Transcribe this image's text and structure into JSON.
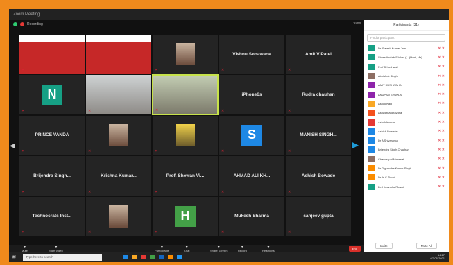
{
  "window": {
    "title": "Zoom Meeting",
    "recording": "Recording",
    "view_label": "View"
  },
  "grid": [
    {
      "name": "",
      "caption": "",
      "type": "video-red"
    },
    {
      "name": "",
      "caption": "",
      "type": "video-red"
    },
    {
      "name": "",
      "caption": "",
      "type": "photo"
    },
    {
      "name": "Vishnu Sonawane",
      "caption": "",
      "type": "name"
    },
    {
      "name": "Amit V Patel",
      "caption": "",
      "type": "name"
    },
    {
      "name": "N",
      "caption": "",
      "type": "avatar",
      "color": "#16a085"
    },
    {
      "name": "",
      "caption": "",
      "type": "video-gray"
    },
    {
      "name": "",
      "caption": "",
      "type": "video-green",
      "active": true
    },
    {
      "name": "iPhone6s",
      "caption": "",
      "type": "name"
    },
    {
      "name": "Rudra chauhan",
      "caption": "",
      "type": "name"
    },
    {
      "name": "PRINCE VANDA",
      "caption": "",
      "type": "name"
    },
    {
      "name": "",
      "caption": "",
      "type": "photo"
    },
    {
      "name": "",
      "caption": "",
      "type": "photo-yellow"
    },
    {
      "name": "S",
      "caption": "",
      "type": "avatar",
      "color": "#1e88e5"
    },
    {
      "name": "MANISH SINGH...",
      "caption": "",
      "type": "name"
    },
    {
      "name": "Brijendra Singh...",
      "caption": "",
      "type": "name"
    },
    {
      "name": "Krishna Kumar...",
      "caption": "",
      "type": "name"
    },
    {
      "name": "Prof. Shewan Vi...",
      "caption": "",
      "type": "name"
    },
    {
      "name": "AHMAD ALI KH...",
      "caption": "",
      "type": "name"
    },
    {
      "name": "Ashish Bowade",
      "caption": "",
      "type": "name"
    },
    {
      "name": "Technocrats Inst...",
      "caption": "",
      "type": "name"
    },
    {
      "name": "",
      "caption": "",
      "type": "photo"
    },
    {
      "name": "H",
      "caption": "",
      "type": "avatar",
      "color": "#43a047"
    },
    {
      "name": "Mukesh Sharma",
      "caption": "",
      "type": "name"
    },
    {
      "name": "sanjeev gupta",
      "caption": "",
      "type": "name"
    }
  ],
  "bottombar": [
    {
      "label": "Mute",
      "icon": "microphone-icon"
    },
    {
      "label": "Start Video",
      "icon": "video-icon"
    },
    {
      "label": "Participants",
      "icon": "participants-icon"
    },
    {
      "label": "Chat",
      "icon": "chat-icon"
    },
    {
      "label": "Share Screen",
      "icon": "share-icon"
    },
    {
      "label": "Record",
      "icon": "record-icon"
    },
    {
      "label": "Reactions",
      "icon": "reaction-icon"
    }
  ],
  "end_label": "End",
  "panel": {
    "title": "Participants (31)",
    "search_placeholder": "Find a participant",
    "items": [
      {
        "name": "Dr. Rajesh Kumar Jain",
        "color": "#16a085"
      },
      {
        "name": "Shree Amitab Sridhar (... (Host, Me)",
        "color": "#16a085"
      },
      {
        "name": "Prof D Kushwah",
        "color": "#16a085"
      },
      {
        "name": "Abhishek Singh",
        "color": "#8d6e63"
      },
      {
        "name": "AMIT KUSHWAHA",
        "color": "#8e24aa"
      },
      {
        "name": "ANUPAM SHUKLA",
        "color": "#8e24aa"
      },
      {
        "name": "Ashok Kaul",
        "color": "#f9a825"
      },
      {
        "name": "Ashwathanarayana",
        "color": "#f4511e"
      },
      {
        "name": "Ashok Kumar",
        "color": "#e53935"
      },
      {
        "name": "Ashish Bowade",
        "color": "#1e88e5"
      },
      {
        "name": "Dr A Shivaramu",
        "color": "#1e88e5"
      },
      {
        "name": "Brijendra Singh Chauhan",
        "color": "#1e88e5"
      },
      {
        "name": "Chandrapal Nimawat",
        "color": "#8d6e63"
      },
      {
        "name": "Dr Digvendra Kumar Singh",
        "color": "#fb8c00"
      },
      {
        "name": "Dr. K C Tiwari",
        "color": "#fb8c00"
      },
      {
        "name": "Dr. Himanshu Rawat",
        "color": "#16a085"
      }
    ],
    "invite_label": "Invite",
    "mute_all_label": "Mute All"
  },
  "taskbar": {
    "search_placeholder": "Type here to search",
    "time": "14:27",
    "date": "07-08-2021"
  }
}
